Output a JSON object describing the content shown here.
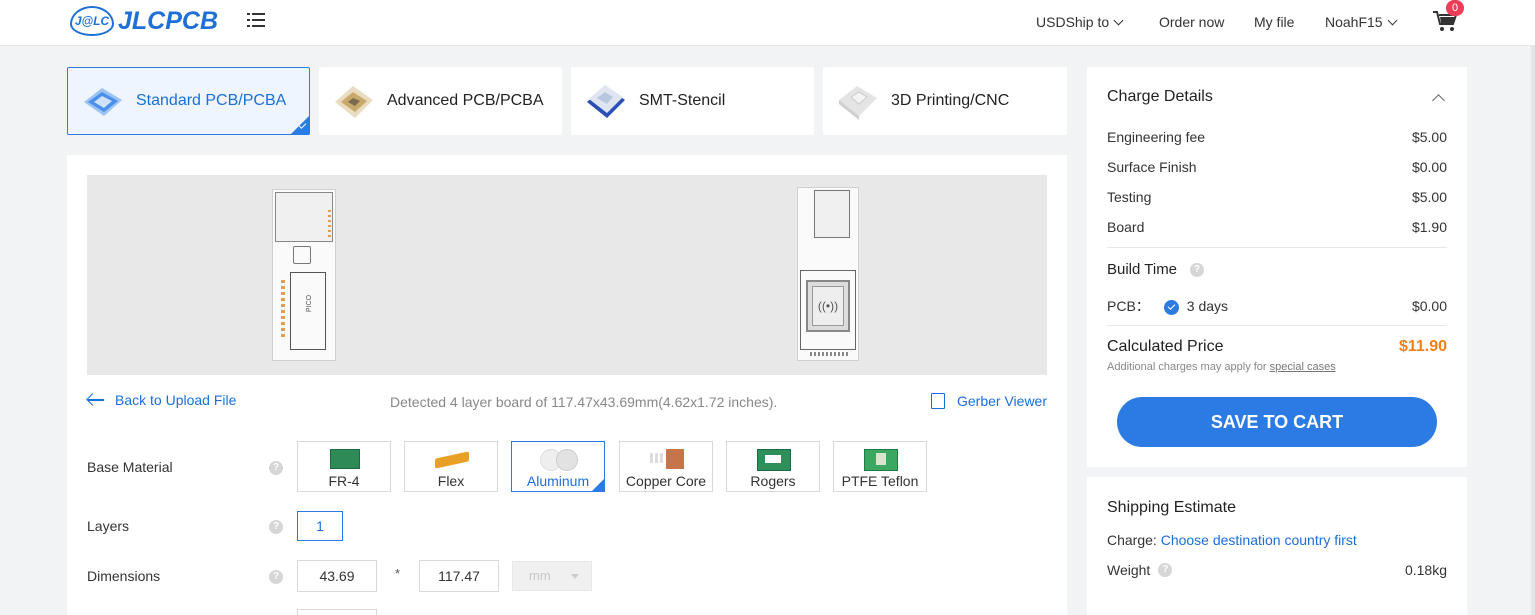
{
  "header": {
    "logo_badge": "J@LC",
    "logo_text": "JLCPCB",
    "nav": {
      "currency": "USD",
      "ship_to": "Ship to",
      "order_now": "Order now",
      "my_file": "My file",
      "user": "NoahF15"
    },
    "cart_count": "0"
  },
  "product_tabs": [
    {
      "label": "Standard PCB/PCBA",
      "active": true
    },
    {
      "label": "Advanced PCB/PCBA",
      "active": false
    },
    {
      "label": "SMT-Stencil",
      "active": false
    },
    {
      "label": "3D Printing/CNC",
      "active": false
    }
  ],
  "upload": {
    "back_link": "Back to Upload File",
    "detected": "Detected 4 layer board of 117.47x43.69mm(4.62x1.72 inches).",
    "gerber_viewer": "Gerber Viewer",
    "board_silkscreen": "PICO"
  },
  "options": {
    "base_material": {
      "label": "Base Material",
      "help": "?",
      "items": [
        {
          "label": "FR-4",
          "selected": false
        },
        {
          "label": "Flex",
          "selected": false
        },
        {
          "label": "Aluminum",
          "selected": true
        },
        {
          "label": "Copper Core",
          "selected": false
        },
        {
          "label": "Rogers",
          "selected": false
        },
        {
          "label": "PTFE Teflon",
          "selected": false
        }
      ]
    },
    "layers": {
      "label": "Layers",
      "help": "?",
      "value": "1"
    },
    "dimensions": {
      "label": "Dimensions",
      "help": "?",
      "width": "43.69",
      "separator": "*",
      "height": "117.47",
      "unit": "mm"
    }
  },
  "charge": {
    "title": "Charge Details",
    "rows": [
      {
        "label": "Engineering fee",
        "value": "$5.00"
      },
      {
        "label": "Surface Finish",
        "value": "$0.00"
      },
      {
        "label": "Testing",
        "value": "$5.00"
      },
      {
        "label": "Board",
        "value": "$1.90"
      }
    ],
    "build_time": {
      "label": "Build Time",
      "help": "?",
      "pcb_label": "PCB：",
      "days": "3 days",
      "price": "$0.00"
    },
    "calculated": {
      "label": "Calculated Price",
      "value": "$11.90"
    },
    "note_prefix": "Additional charges may apply for ",
    "note_link": "special cases",
    "save_button": "SAVE TO CART"
  },
  "shipping": {
    "title": "Shipping Estimate",
    "charge_label": "Charge:",
    "charge_link": "Choose destination country first",
    "weight_label": "Weight",
    "weight_help": "?",
    "weight_value": "0.18kg"
  },
  "colors": {
    "brand": "#1f6fd6",
    "accent": "#2c7be5",
    "price": "#f47f15",
    "badge": "#f03c59"
  }
}
